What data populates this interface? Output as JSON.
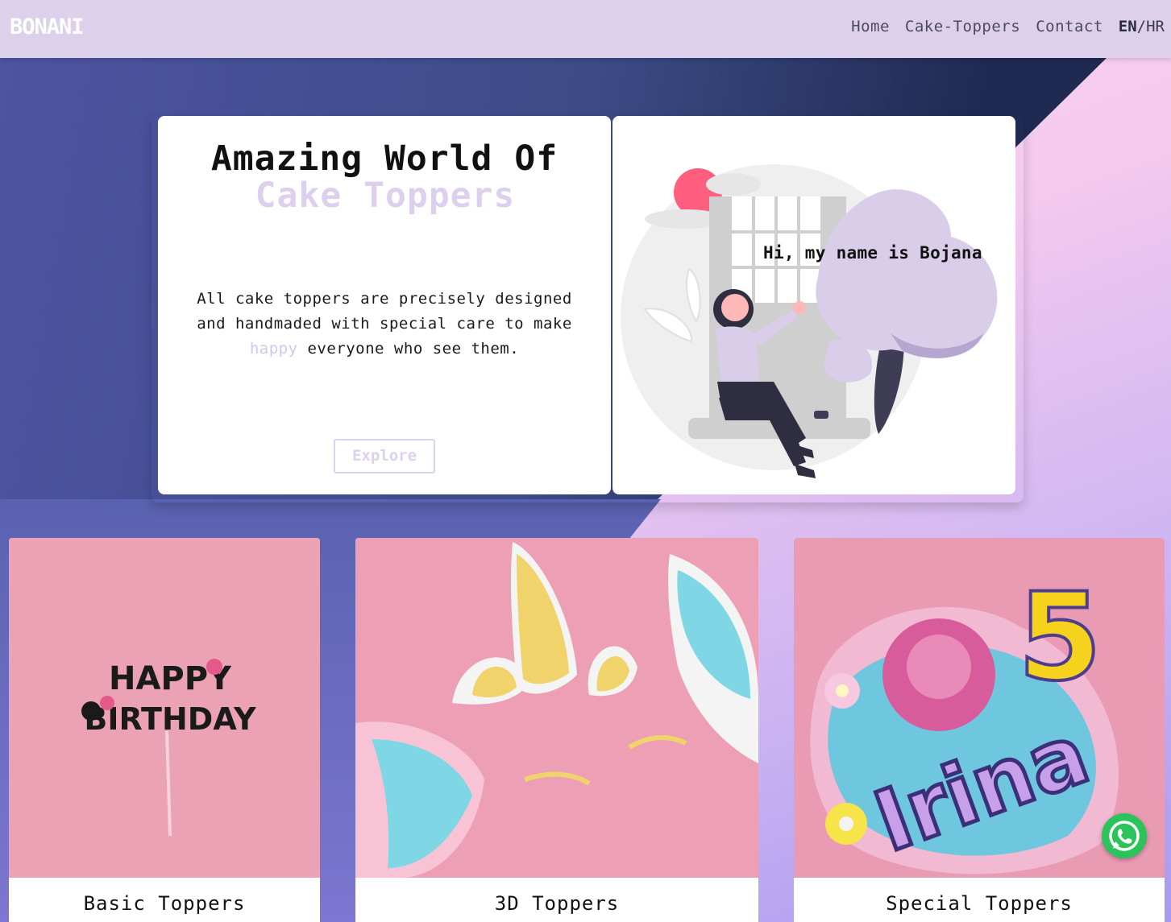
{
  "navbar": {
    "brand": "BONANI",
    "links": [
      "Home",
      "Cake-Toppers",
      "Contact"
    ],
    "lang_active": "EN",
    "lang_sep": "/",
    "lang_other": "HR"
  },
  "hero": {
    "title_line1": "Amazing World Of",
    "title_line2": "Cake Toppers",
    "desc_before": "All cake toppers are precisely designed and handmaded with special care to make ",
    "desc_highlight": "happy",
    "desc_after": " everyone who see them.",
    "explore_label": "Explore",
    "greeting": "Hi, my name is Bojana"
  },
  "cards": [
    {
      "label": "Basic Toppers",
      "image_text": "HAPPY BIRTHDAY"
    },
    {
      "label": "3D Toppers"
    },
    {
      "label": "Special Toppers",
      "image_text": "Irina",
      "image_number": "5"
    }
  ],
  "colors": {
    "navbar_bg": "#dcd0ea",
    "accent_lavender": "#dcd0ee",
    "whatsapp_green": "#2bc45a"
  },
  "icons": [
    "whatsapp-icon"
  ]
}
